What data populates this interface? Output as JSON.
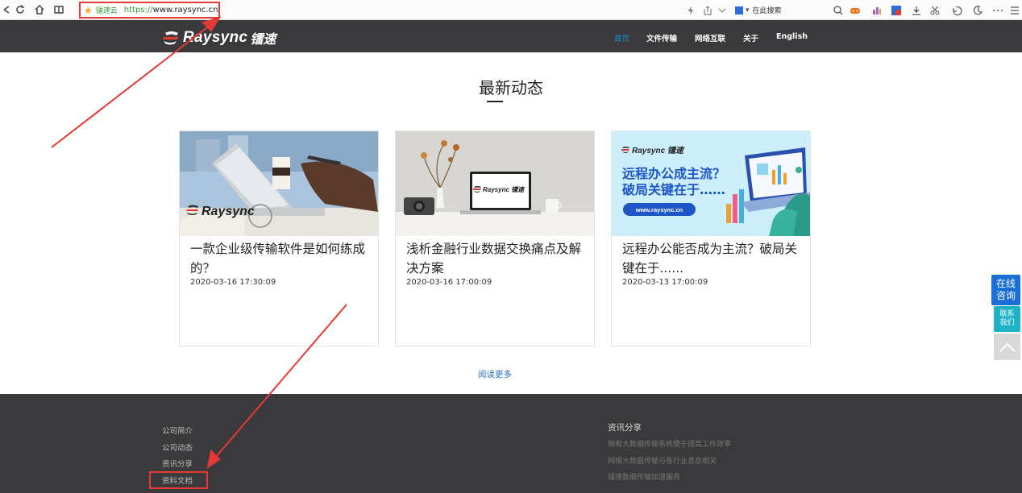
{
  "browser": {
    "site_name": "镭速云",
    "url_protocol": "https://",
    "url_domain": "www.raysync.cn",
    "search_placeholder": "在此搜索",
    "highlight_color": "#e53935"
  },
  "header": {
    "logo_text": "Raysync",
    "logo_cn": "镭速",
    "nav": [
      {
        "label": "首页",
        "active": true
      },
      {
        "label": "文件传输",
        "active": false
      },
      {
        "label": "网络互联",
        "active": false
      },
      {
        "label": "关于",
        "active": false
      },
      {
        "label": "English",
        "active": false
      }
    ],
    "bg_color": "#3a3a3c",
    "active_color": "#1e8bd6"
  },
  "news": {
    "section_title": "最新动态",
    "cards": [
      {
        "title": "一款企业级传输软件是如何练成的？",
        "date": "2020-03-16 17:30:09",
        "image_brand": "Raysync"
      },
      {
        "title": "浅析金融行业数据交换痛点及解决方案",
        "date": "2020-03-16 17:00:09",
        "image_brand": "Raysync 镭速"
      },
      {
        "title": "远程办公能否成为主流？破局关键在于......",
        "date": "2020-03-13 17:00:09",
        "image_brand": "Raysync 镭速",
        "image_headline_1": "远程办公成主流？",
        "image_headline_2": "破局关键在于……",
        "image_url": "www.raysync.cn"
      }
    ],
    "read_more": "阅读更多"
  },
  "footer": {
    "links": [
      "公司简介",
      "公司动态",
      "资讯分享",
      "资料文档"
    ],
    "right_title": "资讯分享",
    "articles": [
      "拥有大数据传输系统便于提高工作效率",
      "网络大数据传输与各行业息息相关",
      "镭速数据传输加速服务"
    ]
  },
  "floating": {
    "chat_label_1": "在线",
    "chat_label_2": "咨询",
    "contact_label_1": "联系",
    "contact_label_2": "我们"
  }
}
